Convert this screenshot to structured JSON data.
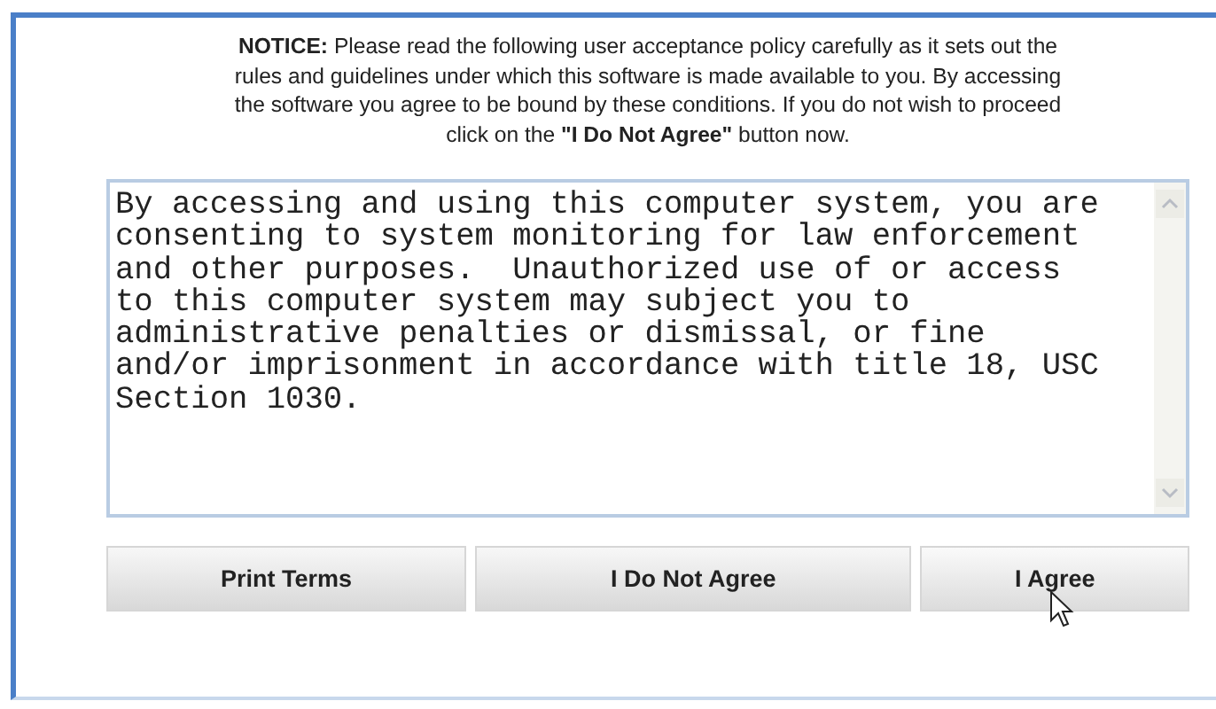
{
  "notice": "**NOTICE:** Please read the following user acceptance policy carefully as it sets out the rules and guidelines under which this software is made available to you. By accessing the software you agree to be bound by these conditions. If you do not wish to proceed click on the **\"I Do Not Agree\"** button now.",
  "terms_text": "By accessing and using this computer system, you are consenting to system monitoring for law enforcement and other purposes.  Unauthorized use of or access to this computer system may subject you to administrative penalties or dismissal, or fine and/or imprisonment in accordance with title 18, USC Section 1030.",
  "buttons": [
    {
      "label": "Print Terms",
      "hovered": false
    },
    {
      "label": "I Do Not Agree",
      "hovered": false
    },
    {
      "label": "I Agree",
      "hovered": true
    }
  ]
}
